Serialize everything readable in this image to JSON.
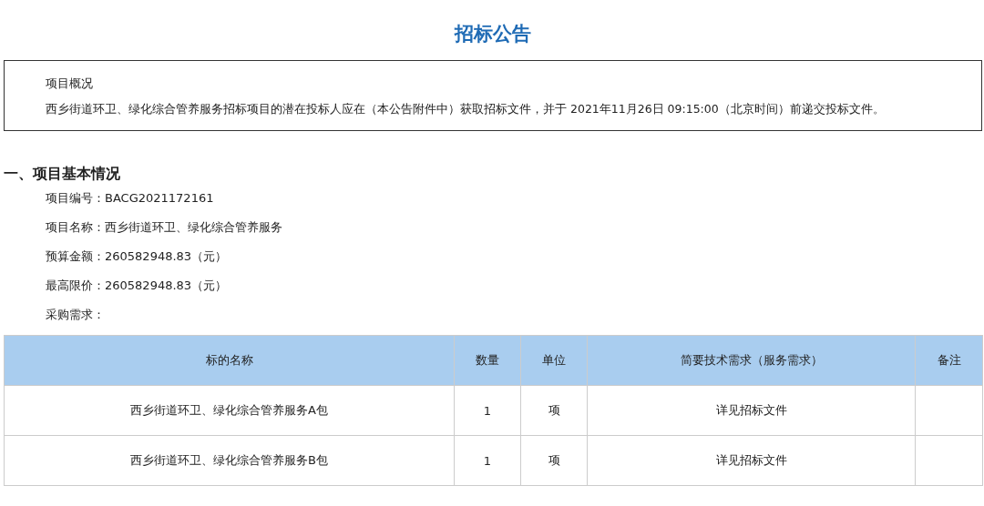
{
  "title": "招标公告",
  "overview": {
    "heading": "项目概况",
    "text": "西乡街道环卫、绿化综合管养服务招标项目的潜在投标人应在（本公告附件中）获取招标文件，并于 2021年11月26日 09:15:00（北京时间）前递交投标文件。"
  },
  "section": {
    "heading": "一、项目基本情况",
    "fields": [
      {
        "text": "项目编号：BACG2021172161"
      },
      {
        "text": "项目名称：西乡街道环卫、绿化综合管养服务"
      },
      {
        "text": "预算金额：260582948.83（元）"
      },
      {
        "text": "最高限价：260582948.83（元）"
      },
      {
        "text": "采购需求："
      }
    ]
  },
  "table": {
    "columns": [
      "标的名称",
      "数量",
      "单位",
      "简要技术需求（服务需求）",
      "备注"
    ],
    "rows": [
      [
        "西乡街道环卫、绿化综合管养服务A包",
        "1",
        "项",
        "详见招标文件",
        ""
      ],
      [
        "西乡街道环卫、绿化综合管养服务B包",
        "1",
        "项",
        "详见招标文件",
        ""
      ]
    ]
  }
}
